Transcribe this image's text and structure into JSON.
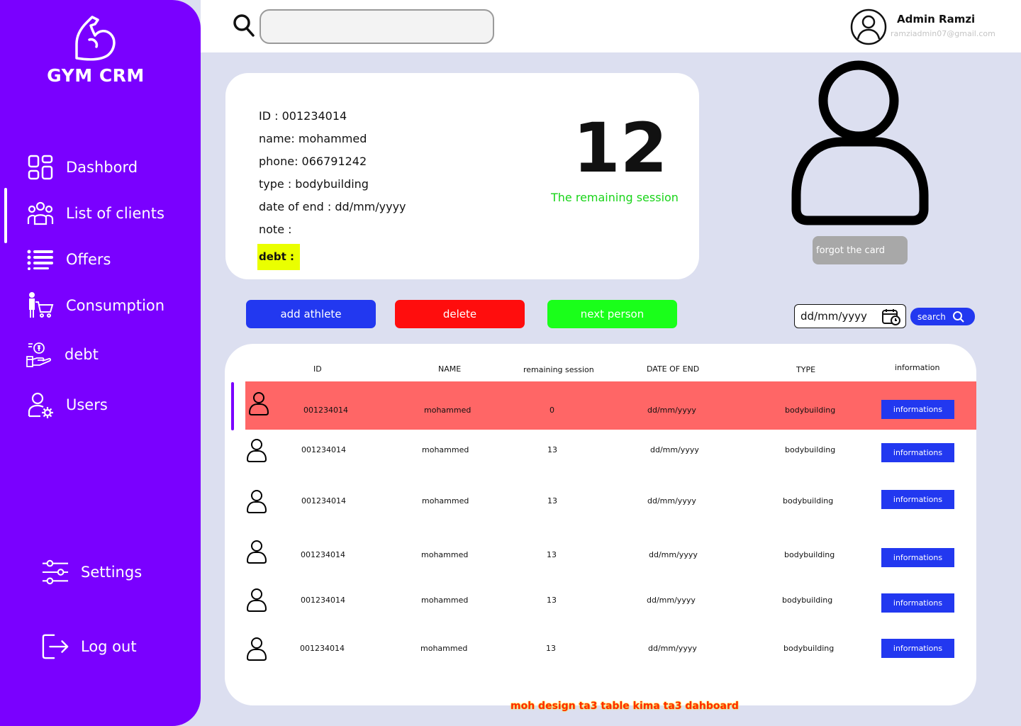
{
  "brand": {
    "name": "GYM CRM"
  },
  "sidebar": {
    "items": [
      {
        "label": "Dashbord",
        "icon": "grid-icon"
      },
      {
        "label": "List of clients",
        "icon": "group-icon"
      },
      {
        "label": "Offers",
        "icon": "list-icon"
      },
      {
        "label": "Consumption",
        "icon": "cart-icon"
      },
      {
        "label": "debt",
        "icon": "money-hand-icon"
      },
      {
        "label": "Users",
        "icon": "user-gear-icon"
      }
    ],
    "settings_label": "Settings",
    "logout_label": "Log out",
    "active_item": "List of clients"
  },
  "header": {
    "search_value": "",
    "admin_name": "Admin Ramzi",
    "admin_email": "ramziadmin07@gmail.com"
  },
  "client": {
    "id_line": "ID : 001234014",
    "name_line": "name: mohammed",
    "phone_line": "phone: 066791242",
    "type_line": "type : bodybuilding",
    "end_line": "date of end : dd/mm/yyyy",
    "note_line": "note :",
    "debt_line": "debt :",
    "remaining_count": "12",
    "remaining_label": "The remaining session",
    "forgot_card_label": "forgot the card"
  },
  "actions": {
    "add_label": "add athlete",
    "delete_label": "delete",
    "next_label": "next person",
    "date_value": "dd/mm/yyyy",
    "search_label": "search"
  },
  "table": {
    "headers": [
      "ID",
      "NAME",
      "remaining session",
      "DATE OF END",
      "TYPE",
      "information"
    ],
    "rows": [
      {
        "id": "001234014",
        "name": "mohammed",
        "remaining": "0",
        "end": "dd/mm/yyyy",
        "type": "bodybuilding",
        "action": "informations"
      },
      {
        "id": "001234014",
        "name": "mohammed",
        "remaining": "13",
        "end": "dd/mm/yyyy",
        "type": "bodybuilding",
        "action": "informations"
      },
      {
        "id": "001234014",
        "name": "mohammed",
        "remaining": "13",
        "end": "dd/mm/yyyy",
        "type": "bodybuilding",
        "action": "informations"
      },
      {
        "id": "001234014",
        "name": "mohammed",
        "remaining": "13",
        "end": "dd/mm/yyyy",
        "type": "bodybuilding",
        "action": "informations"
      },
      {
        "id": "001234014",
        "name": "mohammed",
        "remaining": "13",
        "end": "dd/mm/yyyy",
        "type": "bodybuilding",
        "action": "informations"
      },
      {
        "id": "001234014",
        "name": "mohammed",
        "remaining": "13",
        "end": "dd/mm/yyyy",
        "type": "bodybuilding",
        "action": "informations"
      }
    ]
  },
  "footer_note": "moh design ta3 table kima ta3 dahboard",
  "colors": {
    "sidebar": "#7a00ff",
    "primary_button": "#2238f0",
    "delete_button": "#ff0d0d",
    "next_button": "#1aff1a",
    "highlight_row": "#ff6666",
    "remaining_label": "#18d418",
    "debt_highlight": "#eaff00"
  }
}
